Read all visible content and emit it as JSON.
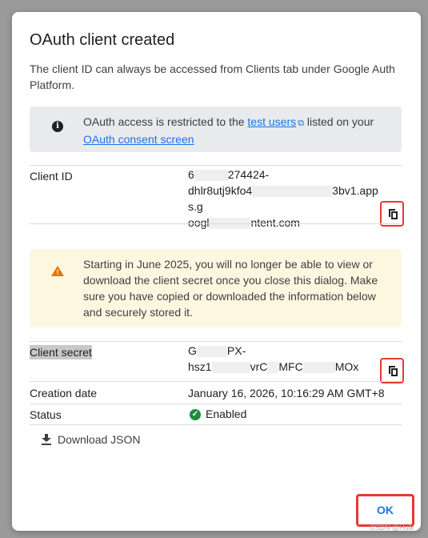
{
  "dialog": {
    "title": "OAuth client created",
    "intro": "The client ID can always be accessed from Clients tab under Google Auth Platform."
  },
  "info": {
    "icon": "info-icon",
    "text_before": "OAuth access is restricted to the ",
    "link_test_users": "test users",
    "text_middle": " listed on your ",
    "link_consent": "OAuth consent screen"
  },
  "client_id": {
    "label": "Client ID",
    "line1_a": "6",
    "line1_b": "274424-",
    "line2_a": "dhlr8utj9kfo4",
    "line2_b": "3bv1.apps.g",
    "line3_a": "oogl",
    "line3_b": "ntent.com"
  },
  "warning": {
    "icon": "warning-icon",
    "text": "Starting in June 2025, you will no longer be able to view or download the client secret once you close this dialog. Make sure you have copied or downloaded the information below and securely stored it."
  },
  "client_secret": {
    "label": "Client secret",
    "line1_a": "G",
    "line1_b": "PX-",
    "line2_a": "hsz1",
    "line2_b": "vrC",
    "line2_c": "MFC",
    "line2_d": "MOx"
  },
  "creation": {
    "label": "Creation date",
    "value": "January 16, 2026, 10:16:29 AM GMT+8"
  },
  "status": {
    "label": "Status",
    "value": "Enabled",
    "color": "#1e8e3e"
  },
  "actions": {
    "download": "Download JSON",
    "ok": "OK"
  },
  "watermark": "CSDN @Hulk"
}
